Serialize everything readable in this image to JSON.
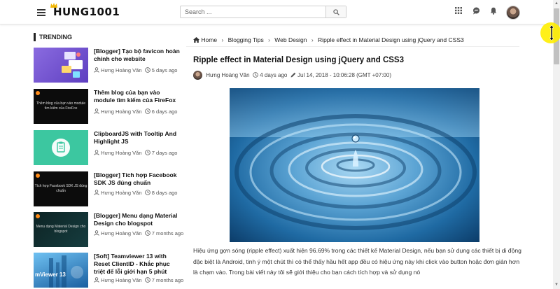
{
  "header": {
    "logo_text": "HUNG1001",
    "search_placeholder": "Search ...",
    "icons": [
      "menu-icon",
      "search-icon",
      "apps-grid-icon",
      "chat-icon",
      "bell-icon",
      "user-avatar"
    ]
  },
  "sidebar": {
    "heading": "TRENDING",
    "items": [
      {
        "title": "[Blogger] Tạo bộ favicon hoàn chỉnh cho website",
        "author": "Hưng Hoàng Văn",
        "time": "5 days ago",
        "thumb_color": "#7a5ad1",
        "thumb_text": ""
      },
      {
        "title": "Thêm blog của bạn vào module tìm kiếm của FireFox",
        "author": "Hưng Hoàng Văn",
        "time": "6 days ago",
        "thumb_color": "#0c0c0c",
        "thumb_text": "Thêm blog của bạn vào module tìm kiếm của FireFox"
      },
      {
        "title": "ClipboardJS with Tooltip And Highlight JS",
        "author": "Hưng Hoàng Văn",
        "time": "7 days ago",
        "thumb_color": "#3cc7a0",
        "thumb_text": ""
      },
      {
        "title": "[Blogger] Tích hợp Facebook SDK JS đúng chuẩn",
        "author": "Hưng Hoàng Văn",
        "time": "8 days ago",
        "thumb_color": "#0c0c0c",
        "thumb_text": "Tích hợp Facebook SDK JS đúng chuẩn"
      },
      {
        "title": "[Blogger] Menu dạng Material Design cho blogspot",
        "author": "Hưng Hoàng Văn",
        "time": "7 months ago",
        "thumb_color": "#0f2a2c",
        "thumb_text": "Menu dạng Material Design cho blogspot"
      },
      {
        "title": "[Soft] Teamviewer 13 with Reset ClientID - Khắc phục triệt để lỗi giới hạn 5 phút",
        "author": "Hưng Hoàng Văn",
        "time": "7 months ago",
        "thumb_color": "#1d6fb0",
        "thumb_text": "mViewer 13"
      }
    ]
  },
  "breadcrumb": {
    "items": [
      "Home",
      "Blogging Tips",
      "Web Design",
      "Ripple effect in Material Design using jQuery and CSS3"
    ]
  },
  "post": {
    "title": "Ripple effect in Material Design using jQuery and CSS3",
    "author": "Hưng Hoàng Văn",
    "time_ago": "4 days ago",
    "date": "Jul 14, 2018 - 10:06:28 (GMT +07:00)",
    "body": "Hiệu ứng gợn sóng (ripple effect) xuất hiện 96.69% trong các thiết kế Material Design, nếu bạn sử dụng các thiết bị di động đặc biệt là Android, tinh ý một chút thì có thể thấy hầu hết app đều có hiệu ứng này khi click vào button hoặc đơn giản hơn là chạm vào. Trong bài viết này tôi sẽ giới thiệu cho bạn cách tích hợp và sử dụng nó"
  },
  "colors": {
    "accent": "#222222",
    "cursor_highlight": "#ffee00",
    "water_dark": "#0d3f6b",
    "water_light": "#9fd0ee"
  }
}
